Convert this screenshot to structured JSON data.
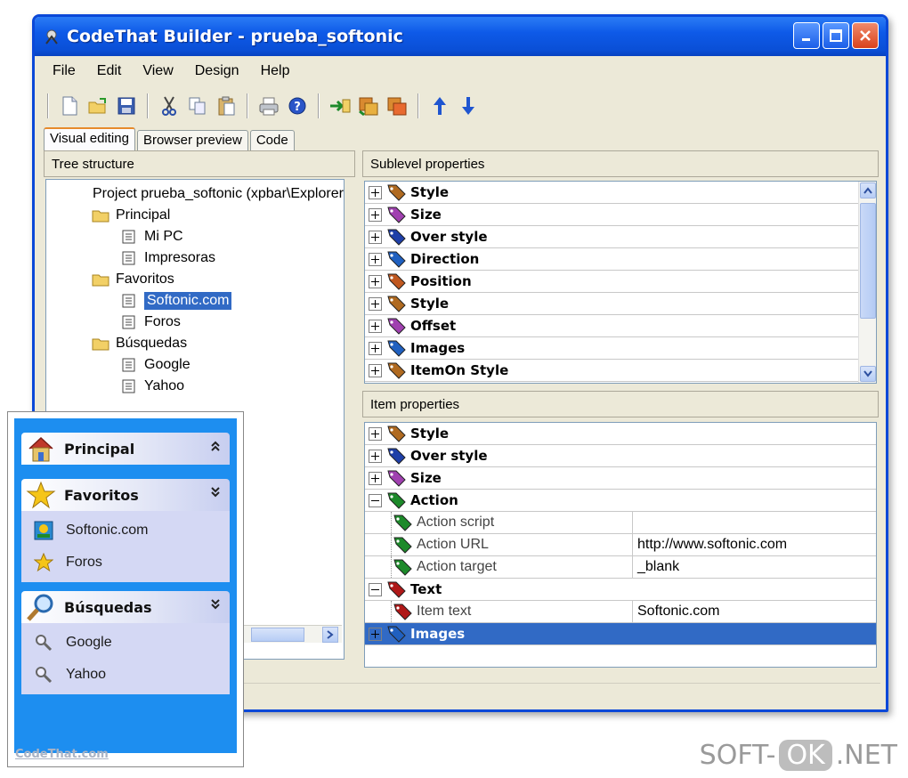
{
  "window": {
    "title": "CodeThat Builder - prueba_softonic"
  },
  "menu": [
    "File",
    "Edit",
    "View",
    "Design",
    "Help"
  ],
  "toolbar_icons": [
    "new-file-icon",
    "open-folder-icon",
    "save-icon",
    "cut-icon",
    "copy-icon",
    "paste-icon",
    "print-icon",
    "help-icon",
    "insert-item-icon",
    "add-sublevel-icon",
    "remove-item-icon",
    "move-up-icon",
    "move-down-icon"
  ],
  "tabs": [
    {
      "label": "Visual editing",
      "active": true
    },
    {
      "label": "Browser preview",
      "active": false
    },
    {
      "label": "Code",
      "active": false
    }
  ],
  "tree": {
    "header": "Tree structure",
    "root": "Project prueba_softonic (xpbar\\Explorer",
    "nodes": [
      {
        "label": "Principal",
        "type": "folder"
      },
      {
        "label": "Mi PC",
        "type": "item"
      },
      {
        "label": "Impresoras",
        "type": "item"
      },
      {
        "label": "Favoritos",
        "type": "folder"
      },
      {
        "label": "Softonic.com",
        "type": "item",
        "selected": true
      },
      {
        "label": "Foros",
        "type": "item"
      },
      {
        "label": "Búsquedas",
        "type": "folder"
      },
      {
        "label": "Google",
        "type": "item"
      },
      {
        "label": "Yahoo",
        "type": "item"
      }
    ]
  },
  "sublevel": {
    "header": "Sublevel properties",
    "rows": [
      {
        "label": "Style",
        "color": "#b06a20"
      },
      {
        "label": "Size",
        "color": "#a040b0"
      },
      {
        "label": "Over style",
        "color": "#1e3fa8"
      },
      {
        "label": "Direction",
        "color": "#2060c0"
      },
      {
        "label": "Position",
        "color": "#c05820"
      },
      {
        "label": "Style",
        "color": "#b06a20"
      },
      {
        "label": "Offset",
        "color": "#a040b0"
      },
      {
        "label": "Images",
        "color": "#2060c0"
      },
      {
        "label": "ItemOn Style",
        "color": "#b06a20"
      }
    ]
  },
  "item_props": {
    "header": "Item properties",
    "rows": [
      {
        "label": "Style",
        "exp": "+",
        "color": "#b06a20"
      },
      {
        "label": "Over style",
        "exp": "+",
        "color": "#1e3fa8"
      },
      {
        "label": "Size",
        "exp": "+",
        "color": "#a040b0"
      },
      {
        "label": "Action",
        "exp": "−",
        "color": "#1d8a2a"
      },
      {
        "label": "Action script",
        "child": true,
        "value": "",
        "color": "#1d8a2a"
      },
      {
        "label": "Action URL",
        "child": true,
        "value": "http://www.softonic.com",
        "color": "#1d8a2a"
      },
      {
        "label": "Action target",
        "child": true,
        "value": "_blank",
        "color": "#1d8a2a"
      },
      {
        "label": "Text",
        "exp": "−",
        "color": "#b01818"
      },
      {
        "label": "Item text",
        "child": true,
        "value": "Softonic.com",
        "color": "#b01818"
      },
      {
        "label": "Images",
        "exp": "+",
        "selected": true,
        "color": "#2060c0"
      }
    ]
  },
  "preview": {
    "groups": [
      {
        "title": "Principal",
        "icon": "house-icon",
        "chevron": "⌃",
        "items": []
      },
      {
        "title": "Favoritos",
        "icon": "star-icon",
        "chevron": "⌄",
        "items": [
          {
            "label": "Softonic.com",
            "icon": "softonic-icon"
          },
          {
            "label": "Foros",
            "icon": "small-star-icon"
          }
        ]
      },
      {
        "title": "Búsquedas",
        "icon": "magnifier-icon",
        "chevron": "⌄",
        "items": [
          {
            "label": "Google",
            "icon": "small-magnifier-icon"
          },
          {
            "label": "Yahoo",
            "icon": "small-magnifier-icon"
          }
        ]
      }
    ],
    "footer": "CodeThat.com"
  },
  "watermark": {
    "left": "SOFT-",
    "badge": "OK",
    "right": ".NET"
  }
}
